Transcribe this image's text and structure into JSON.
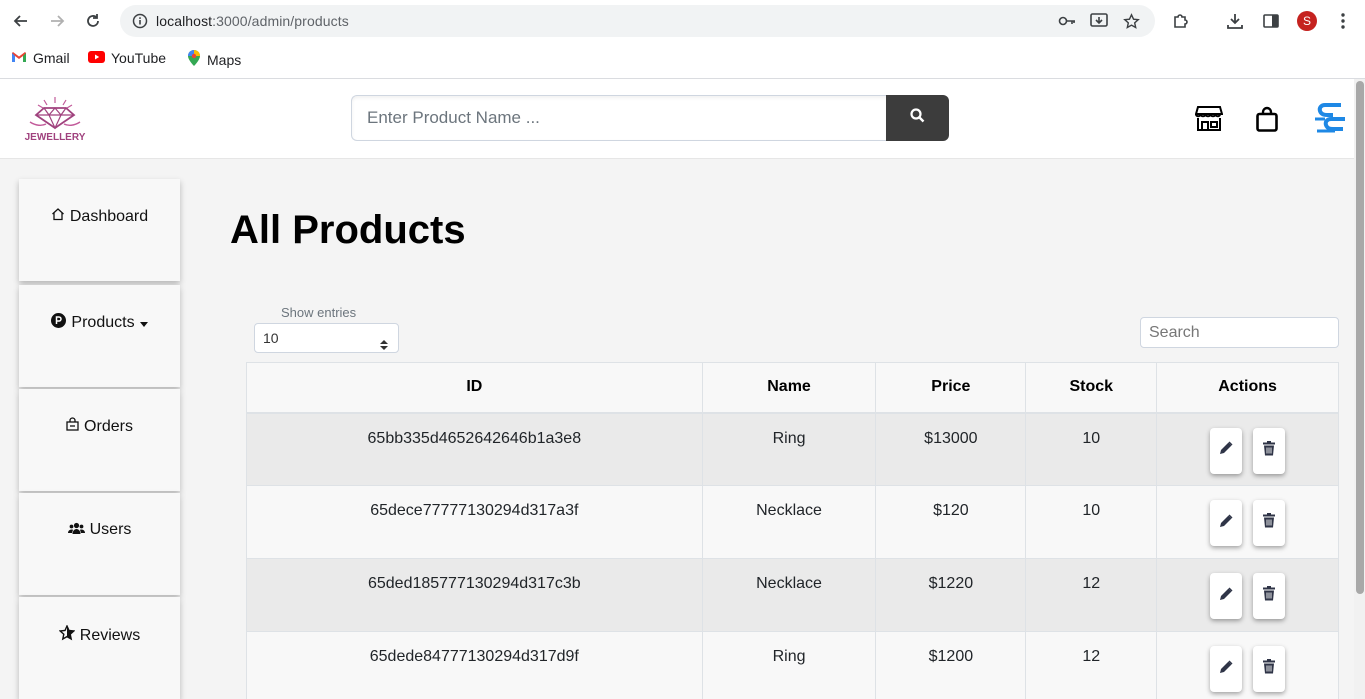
{
  "browser": {
    "url_host": "localhost",
    "url_rest": ":3000/admin/products",
    "profile_initial": "S",
    "bookmarks": [
      {
        "label": "Gmail",
        "icon": "gmail-icon"
      },
      {
        "label": "YouTube",
        "icon": "youtube-icon"
      },
      {
        "label": "Maps",
        "icon": "maps-icon"
      }
    ]
  },
  "header": {
    "logo_text": "JEWELLERY",
    "search_placeholder": "Enter Product Name ...",
    "accent_color": "#1e88e5"
  },
  "sidebar": {
    "items": [
      {
        "label": "Dashboard",
        "icon": "home-icon"
      },
      {
        "label": "Products",
        "icon": "p-circle-icon",
        "dropdown": true
      },
      {
        "label": "Orders",
        "icon": "lock-bag-icon"
      },
      {
        "label": "Users",
        "icon": "users-icon"
      },
      {
        "label": "Reviews",
        "icon": "star-icon"
      }
    ]
  },
  "main": {
    "title": "All Products",
    "show_entries_label": "Show entries",
    "entries_value": "10",
    "search_placeholder": "Search",
    "columns": [
      "ID",
      "Name",
      "Price",
      "Stock",
      "Actions"
    ],
    "rows": [
      {
        "id": "65bb335d4652642646b1a3e8",
        "name": "Ring",
        "price": "$13000",
        "stock": "10"
      },
      {
        "id": "65dece77777130294d317a3f",
        "name": "Necklace",
        "price": "$120",
        "stock": "10"
      },
      {
        "id": "65ded185777130294d317c3b",
        "name": "Necklace",
        "price": "$1220",
        "stock": "12"
      },
      {
        "id": "65dede84777130294d317d9f",
        "name": "Ring",
        "price": "$1200",
        "stock": "12"
      }
    ]
  }
}
